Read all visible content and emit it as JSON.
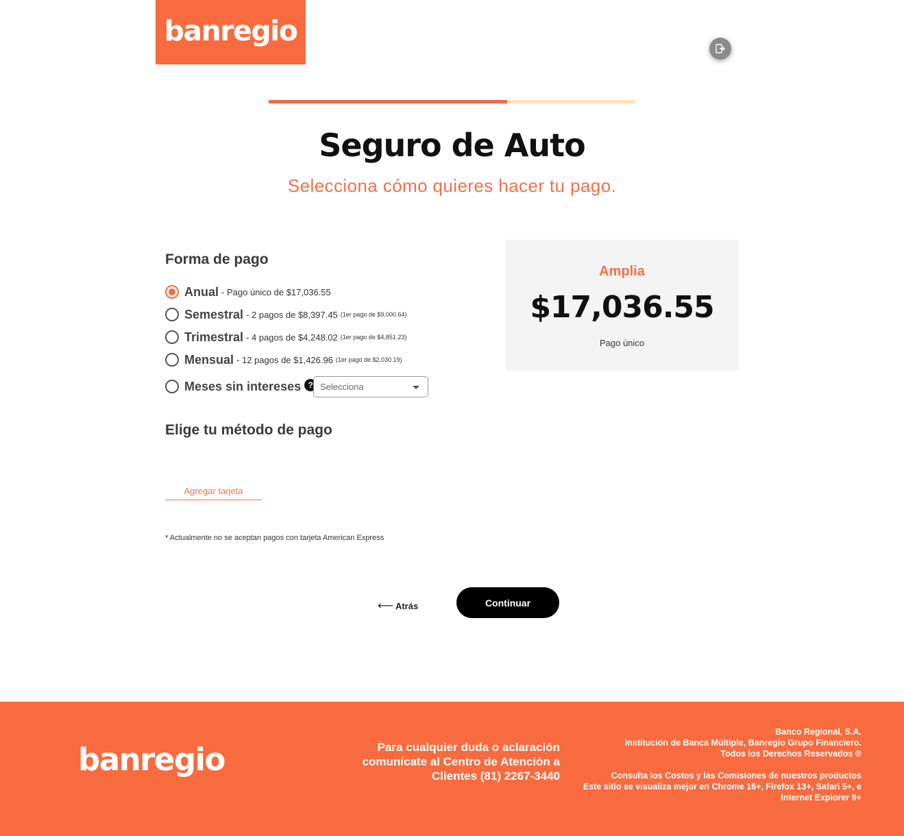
{
  "header": {
    "logo_text": "banregio",
    "exit_icon": "logout-icon"
  },
  "progress": {
    "value": 0.65
  },
  "page": {
    "title": "Seguro de Auto",
    "subtitle": "Selecciona cómo quieres hacer tu pago."
  },
  "payment_form": {
    "title": "Forma de pago",
    "options": [
      {
        "name": "Anual",
        "detail": "- Pago único de $17,036.55",
        "small": "",
        "checked": true
      },
      {
        "name": "Semestral",
        "detail": "- 2 pagos de $8,397.45",
        "small": "(1er pago de $9,000.64)",
        "checked": false
      },
      {
        "name": "Trimestral",
        "detail": "- 4 pagos de $4,248.02",
        "small": "(1er pago de $4,851.23)",
        "checked": false
      },
      {
        "name": "Mensual",
        "detail": "- 12 pagos de $1,426.96",
        "small": "(1er pago de $2,030.19)",
        "checked": false
      },
      {
        "name": "Meses sin intereses",
        "detail": "",
        "small": "",
        "checked": false
      }
    ],
    "help_symbol": "?",
    "msi_select_placeholder": "Selecciona"
  },
  "payment_method": {
    "title": "Elige tu método de pago",
    "add_card_label": "Agregar tarjeta",
    "note": "* Actualmente no se aceptan pagos con tarjeta American Express"
  },
  "summary": {
    "plan": "Amplia",
    "price": "$17,036.55",
    "label": "Pago único"
  },
  "actions": {
    "back_arrow": "⟵",
    "back_label": "Atrás",
    "continue_label": "Continuar"
  },
  "footer": {
    "logo_text": "banregio",
    "contact_lines": [
      "Para cualquier duda o aclaración",
      "comunícate al Centro de Atención a",
      "Clientes (81) 2267-3440"
    ],
    "legal_lines": [
      "Banco Regional, S.A.",
      "Institución de Banca Múltiple, Banregio Grupo Financiero.",
      "Todos los Derechos Reservados ®"
    ],
    "legal_lines_2": [
      "Consulta los Costos y las Comisiones de nuestros productos",
      "Este sitio se visualiza mejor en Chrome 16+, Firefox 13+, Safari 5+, e",
      "Internet Explorer 9+"
    ]
  },
  "colors": {
    "brand": "#f86b3f",
    "accent_text": "#f2704a",
    "progress_track": "#fde3b4",
    "summary_bg": "#f4f4f4",
    "button": "#000000"
  }
}
